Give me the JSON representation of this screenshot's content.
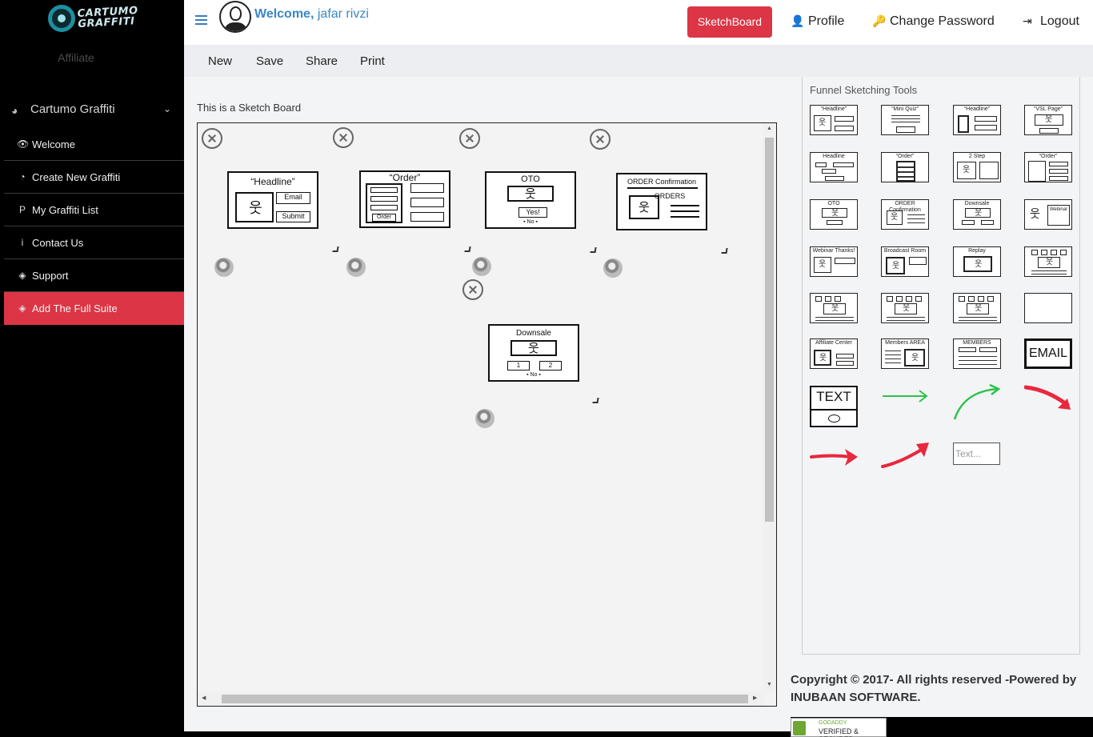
{
  "sidebar": {
    "logo_text_1": "CARTUMO",
    "logo_text_2": "GRAFFITI",
    "affiliate": "Affiliate",
    "section_title": "Cartumo Graffiti",
    "items": [
      {
        "label": "Welcome",
        "icon": "eye-icon",
        "glyph": "👁"
      },
      {
        "label": "Create New Graffiti",
        "icon": "dashboard-icon",
        "glyph": "◔"
      },
      {
        "label": "My Graffiti List",
        "icon": "p-circle-icon",
        "glyph": "P"
      },
      {
        "label": "Contact Us",
        "icon": "info-icon",
        "glyph": "i"
      },
      {
        "label": "Support",
        "icon": "tag-icon",
        "glyph": "◈"
      },
      {
        "label": "Add The Full Suite",
        "icon": "tag-icon",
        "glyph": "◈"
      }
    ]
  },
  "header": {
    "welcome_bold": "Welcome,",
    "welcome_name": "jafar rivzi",
    "sketchboard_button": "SketchBoard",
    "profile": "Profile",
    "change_password": "Change Password",
    "logout": "Logout"
  },
  "menubar": {
    "new": "New",
    "save": "Save",
    "share": "Share",
    "print": "Print"
  },
  "board": {
    "title": "This is a Sketch Board",
    "cards": {
      "headline": {
        "title": "“Headline”",
        "email": "Email",
        "submit": "Submit"
      },
      "order": {
        "title": "“Order”",
        "order_btn": "Order"
      },
      "oto": {
        "title": "OTO",
        "yes": "Yes!",
        "no": "▪ No ▪"
      },
      "confirmation": {
        "title": "ORDER  Confirmation",
        "orders": "ORDERS"
      },
      "downsale": {
        "title": "Downsale",
        "one": "1",
        "two": "2",
        "no": "▪ No ▪"
      }
    }
  },
  "tools": {
    "title": "Funnel Sketching Tools",
    "labels": {
      "headline": "“Headline”",
      "mini_quiz": "“Mini Quiz”",
      "vsl_page": "“VSL Page”",
      "headline_small": "Headline",
      "order": "“Order”",
      "two_step": "2 Step",
      "oto": "OTO",
      "order_confirmation": "ORDER  Confirmation",
      "downsale": "Downsale",
      "webinar": "Webinar",
      "webinar_thanks": "Webinar Thanks!",
      "broadcast_room": "Broadcast Room",
      "replay": "Replay",
      "affiliate_center": "Affiliate Center",
      "members_area": "Members AREA",
      "members": "MEMBERS",
      "email": "EMAIL",
      "text": "TEXT",
      "text_placeholder": "Text..."
    },
    "arrow_colors": {
      "green": "#2ec24a",
      "red": "#e8283d"
    }
  },
  "footer": {
    "copyright": "Copyright © 2017- All rights reserved -Powered by INUBAAN SOFTWARE.",
    "seal_line1": "GODADDY",
    "seal_line2": "VERIFIED & SECURED"
  }
}
